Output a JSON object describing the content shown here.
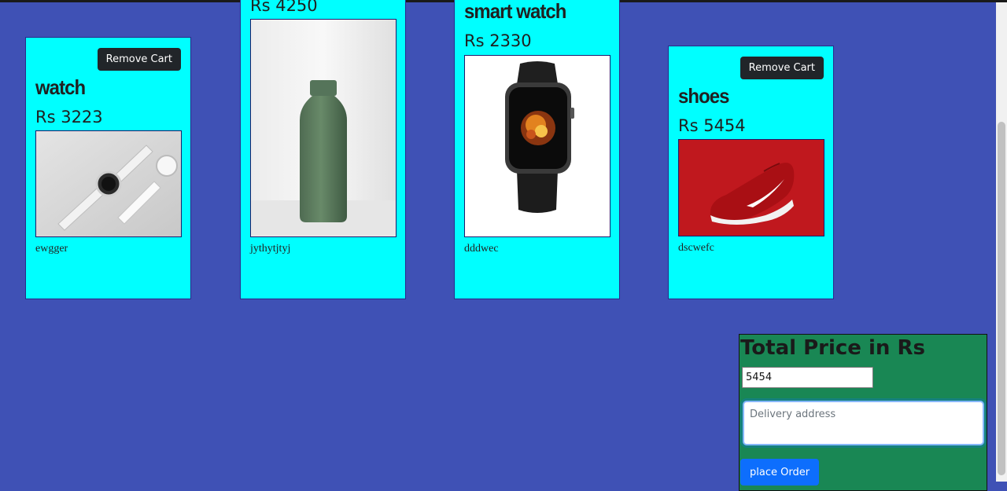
{
  "colors": {
    "page_background": "#3f51b5",
    "card_background": "#00ffff",
    "remove_button": "#212529",
    "total_panel": "#198754",
    "order_button": "#0d6efd"
  },
  "products": [
    {
      "name": "watch",
      "price": "Rs 3223",
      "description": "ewgger",
      "remove_label": "Remove Cart",
      "image": "white-watches-photo"
    },
    {
      "name": "",
      "price": "Rs 4250",
      "description": "jythytjtyj",
      "image": "green-bottle-photo"
    },
    {
      "name": "smart watch",
      "price": "Rs 2330",
      "description": "dddwec",
      "image": "smart-watch-photo"
    },
    {
      "name": "shoes",
      "price": "Rs 5454",
      "description": "dscwefc",
      "remove_label": "Remove Cart",
      "image": "red-shoe-photo"
    }
  ],
  "checkout": {
    "title": "Total Price in Rs",
    "total_value": "5454",
    "address_placeholder": "Delivery address",
    "order_label": "place Order"
  }
}
